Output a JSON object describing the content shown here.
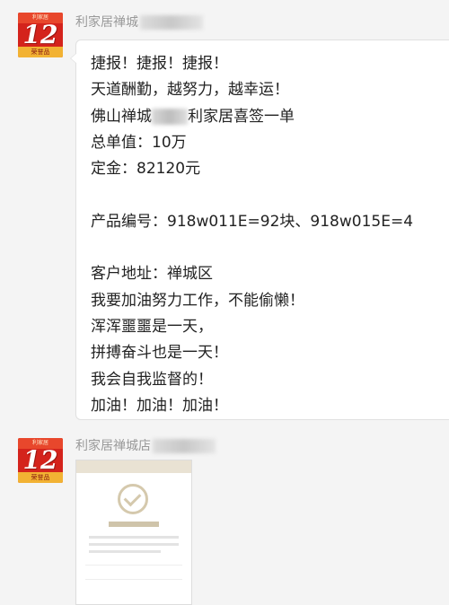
{
  "messages": [
    {
      "sender": "利家居禅城",
      "avatar": {
        "top_text": "利家居",
        "number": "12",
        "badge": "荣誉品"
      },
      "lines": [
        "捷报！捷报！捷报！",
        "天道酬勤，越努力，越幸运！",
        "佛山禅城",
        "利家居喜签一单",
        "总单值：10万",
        "定金：82120元",
        "",
        "产品编号：918w011E=92块、918w015E=4",
        "",
        "客户地址：禅城区",
        "我要加油努力工作，不能偷懒！",
        "浑浑噩噩是一天，",
        "拼搏奋斗也是一天！",
        "我会自我监督的！",
        "加油！加油！加油！"
      ]
    },
    {
      "sender": "利家居禅城店",
      "avatar": {
        "top_text": "利家居",
        "number": "12",
        "badge": "荣誉品"
      },
      "image": {
        "icon": "check-circle-icon"
      }
    }
  ]
}
